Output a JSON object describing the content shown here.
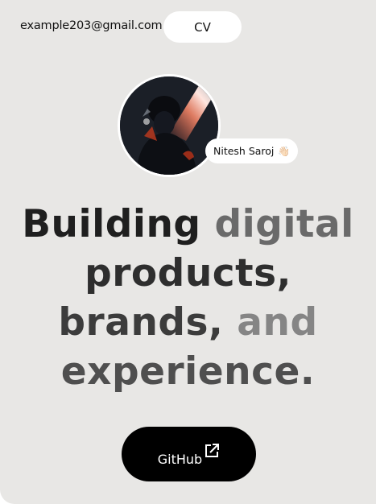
{
  "header": {
    "email": "example203@gmail.com",
    "cv_label": "CV"
  },
  "profile": {
    "name": "Nitesh Saroj",
    "badge_emoji": "👋🏻"
  },
  "headline": {
    "line1": [
      "Building",
      "digital"
    ],
    "line2": [
      "products,"
    ],
    "line3": [
      "brands,",
      "and"
    ],
    "line4": [
      "experience."
    ]
  },
  "cta": {
    "github_label": "GitHub",
    "icon": "external-link-icon"
  },
  "colors": {
    "background": "#e8e7e5",
    "button_dark": "#000000",
    "pill_white": "#ffffff"
  }
}
